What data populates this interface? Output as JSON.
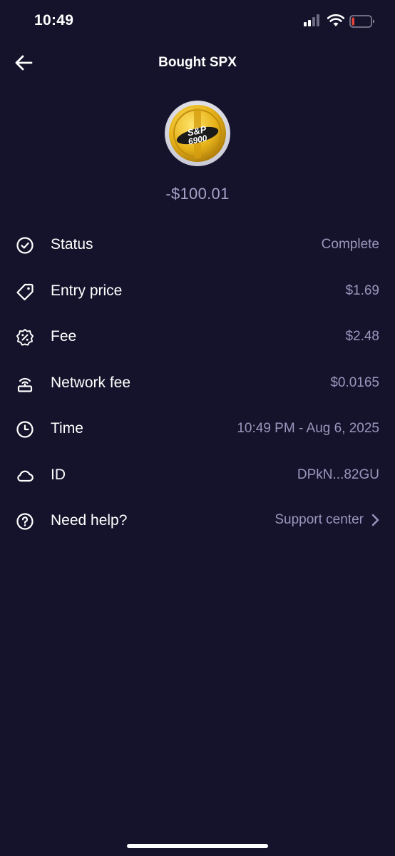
{
  "status_bar": {
    "time": "10:49",
    "battery_color": "#e8453c"
  },
  "header": {
    "title": "Bought SPX",
    "back_icon": "arrow-left-icon"
  },
  "token": {
    "logo_text_top": "S&P",
    "logo_text_bottom": "6900",
    "logo_color": "#e7b319"
  },
  "transaction": {
    "amount": "-$100.01"
  },
  "details": [
    {
      "icon": "check-circle-icon",
      "label": "Status",
      "value": "Complete"
    },
    {
      "icon": "price-tag-icon",
      "label": "Entry price",
      "value": "$1.69"
    },
    {
      "icon": "percent-badge-icon",
      "label": "Fee",
      "value": "$2.48"
    },
    {
      "icon": "network-icon",
      "label": "Network fee",
      "value": "$0.0165"
    },
    {
      "icon": "clock-icon",
      "label": "Time",
      "value": "10:49 PM - Aug 6, 2025"
    },
    {
      "icon": "cloud-icon",
      "label": "ID",
      "value": "DPkN...82GU"
    },
    {
      "icon": "question-circle-icon",
      "label": "Need help?",
      "value": "Support center"
    }
  ],
  "colors": {
    "background": "#15132b",
    "muted_text": "#9a96bd",
    "primary_text": "#ffffff"
  }
}
